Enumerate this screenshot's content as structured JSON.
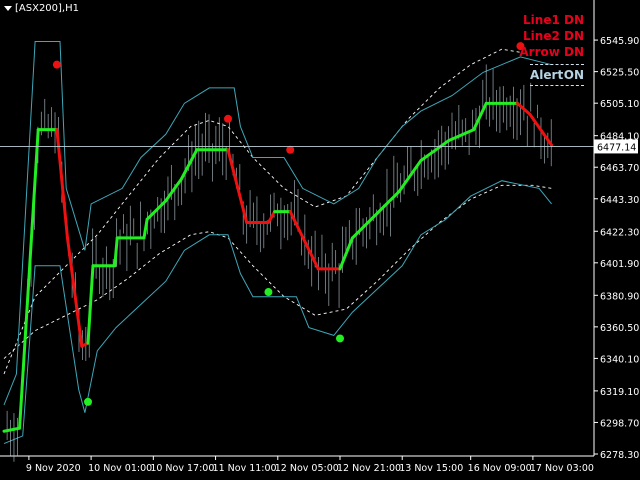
{
  "header": {
    "symbol": "[ASX200],H1"
  },
  "panel": {
    "line1": "Line1 DN",
    "line2": "Line2 DN",
    "arrow": "Arrow  DN",
    "alert_label": "Alert",
    "alert_value": "ON"
  },
  "colors": {
    "background": "#000000",
    "bars": "#b8c8d0",
    "band": "#3fa7b8",
    "envelope": "#ffffff",
    "up": "#22ee22",
    "down": "#ee1111",
    "price_line": "#c0d0d8"
  },
  "chart_data": {
    "type": "line",
    "title": "",
    "xlabel": "",
    "ylabel": "",
    "ylim": [
      6278.3,
      6555.0
    ],
    "x_tick_labels": [
      "9 Nov 2020",
      "10 Nov 01:00",
      "10 Nov 17:00",
      "11 Nov 11:00",
      "12 Nov 05:00",
      "12 Nov 21:00",
      "13 Nov 15:00",
      "16 Nov 09:00",
      "17 Nov 03:00"
    ],
    "y_tick_labels": [
      "6545.90",
      "6525.50",
      "6505.10",
      "6484.10",
      "6463.70",
      "6443.30",
      "6422.30",
      "6401.90",
      "6380.90",
      "6360.50",
      "6340.10",
      "6319.10",
      "6298.70",
      "6278.30"
    ],
    "current_price": "6477.14",
    "trend_steps": [
      {
        "x": 0,
        "y": 6293,
        "dir": "up"
      },
      {
        "x": 2.5,
        "y": 6295,
        "dir": "up"
      },
      {
        "x": 5.5,
        "y": 6488,
        "dir": "up"
      },
      {
        "x": 8.5,
        "y": 6488,
        "dir": "down"
      },
      {
        "x": 10.2,
        "y": 6418,
        "dir": "down"
      },
      {
        "x": 12.5,
        "y": 6348,
        "dir": "down"
      },
      {
        "x": 13.5,
        "y": 6350,
        "dir": "up"
      },
      {
        "x": 14.3,
        "y": 6400,
        "dir": "up"
      },
      {
        "x": 17.8,
        "y": 6400,
        "dir": "up"
      },
      {
        "x": 18.2,
        "y": 6418,
        "dir": "up"
      },
      {
        "x": 22.5,
        "y": 6418,
        "dir": "up"
      },
      {
        "x": 23.0,
        "y": 6430,
        "dir": "up"
      },
      {
        "x": 26.0,
        "y": 6442,
        "dir": "up"
      },
      {
        "x": 28.5,
        "y": 6456,
        "dir": "up"
      },
      {
        "x": 31.0,
        "y": 6475,
        "dir": "up"
      },
      {
        "x": 36.0,
        "y": 6475,
        "dir": "down"
      },
      {
        "x": 39.0,
        "y": 6428,
        "dir": "down"
      },
      {
        "x": 42.5,
        "y": 6428,
        "dir": "down"
      },
      {
        "x": 43.5,
        "y": 6435,
        "dir": "up"
      },
      {
        "x": 46.0,
        "y": 6435,
        "dir": "down"
      },
      {
        "x": 50.5,
        "y": 6398,
        "dir": "down"
      },
      {
        "x": 54.0,
        "y": 6398,
        "dir": "up"
      },
      {
        "x": 56.0,
        "y": 6418,
        "dir": "up"
      },
      {
        "x": 60.0,
        "y": 6434,
        "dir": "up"
      },
      {
        "x": 63.5,
        "y": 6448,
        "dir": "up"
      },
      {
        "x": 67.0,
        "y": 6468,
        "dir": "up"
      },
      {
        "x": 71.5,
        "y": 6481,
        "dir": "up"
      },
      {
        "x": 75.5,
        "y": 6488,
        "dir": "up"
      },
      {
        "x": 77.5,
        "y": 6505,
        "dir": "up"
      },
      {
        "x": 82.5,
        "y": 6505,
        "dir": "down"
      },
      {
        "x": 84.5,
        "y": 6498,
        "dir": "down"
      },
      {
        "x": 88.0,
        "y": 6478,
        "dir": "down"
      }
    ],
    "band_upper": [
      [
        0,
        6310
      ],
      [
        2,
        6330
      ],
      [
        5,
        6545
      ],
      [
        9,
        6545
      ],
      [
        10,
        6450
      ],
      [
        13,
        6410
      ],
      [
        14,
        6440
      ],
      [
        19,
        6450
      ],
      [
        22,
        6470
      ],
      [
        26,
        6485
      ],
      [
        29,
        6505
      ],
      [
        33,
        6515
      ],
      [
        37,
        6515
      ],
      [
        38,
        6490
      ],
      [
        40,
        6470
      ],
      [
        45,
        6470
      ],
      [
        48,
        6450
      ],
      [
        53,
        6440
      ],
      [
        57,
        6450
      ],
      [
        60,
        6470
      ],
      [
        64,
        6490
      ],
      [
        67,
        6500
      ],
      [
        72,
        6510
      ],
      [
        77,
        6525
      ],
      [
        83,
        6535
      ],
      [
        88,
        6530
      ]
    ],
    "band_lower": [
      [
        0,
        6285
      ],
      [
        3,
        6290
      ],
      [
        5,
        6400
      ],
      [
        9,
        6400
      ],
      [
        12,
        6320
      ],
      [
        13,
        6305
      ],
      [
        15,
        6345
      ],
      [
        18,
        6360
      ],
      [
        22,
        6375
      ],
      [
        26,
        6390
      ],
      [
        29,
        6410
      ],
      [
        33,
        6420
      ],
      [
        36,
        6420
      ],
      [
        38,
        6395
      ],
      [
        40,
        6380
      ],
      [
        47,
        6380
      ],
      [
        49,
        6360
      ],
      [
        53,
        6355
      ],
      [
        56,
        6370
      ],
      [
        60,
        6385
      ],
      [
        64,
        6400
      ],
      [
        67,
        6420
      ],
      [
        71,
        6430
      ],
      [
        75,
        6445
      ],
      [
        80,
        6455
      ],
      [
        86,
        6450
      ],
      [
        88,
        6440
      ]
    ],
    "envelope_upper": [
      [
        0,
        6330
      ],
      [
        5,
        6380
      ],
      [
        10,
        6400
      ],
      [
        15,
        6420
      ],
      [
        20,
        6445
      ],
      [
        25,
        6470
      ],
      [
        30,
        6490
      ],
      [
        33,
        6494
      ],
      [
        36,
        6490
      ],
      [
        40,
        6470
      ],
      [
        45,
        6450
      ],
      [
        50,
        6438
      ],
      [
        55,
        6445
      ],
      [
        60,
        6470
      ],
      [
        65,
        6495
      ],
      [
        70,
        6515
      ],
      [
        75,
        6530
      ],
      [
        80,
        6540
      ],
      [
        83,
        6538
      ]
    ],
    "envelope_lower": [
      [
        0,
        6340
      ],
      [
        5,
        6358
      ],
      [
        10,
        6368
      ],
      [
        15,
        6378
      ],
      [
        20,
        6392
      ],
      [
        25,
        6408
      ],
      [
        30,
        6420
      ],
      [
        33,
        6422
      ],
      [
        36,
        6418
      ],
      [
        40,
        6400
      ],
      [
        45,
        6380
      ],
      [
        50,
        6368
      ],
      [
        55,
        6372
      ],
      [
        60,
        6390
      ],
      [
        65,
        6410
      ],
      [
        70,
        6428
      ],
      [
        75,
        6443
      ],
      [
        80,
        6452
      ],
      [
        85,
        6452
      ],
      [
        88,
        6450
      ]
    ],
    "markers": [
      {
        "x": 8.5,
        "y": 6530,
        "color": "down"
      },
      {
        "x": 13.5,
        "y": 6312,
        "color": "up"
      },
      {
        "x": 36.0,
        "y": 6495,
        "color": "down"
      },
      {
        "x": 42.5,
        "y": 6383,
        "color": "up"
      },
      {
        "x": 46.0,
        "y": 6475,
        "color": "down"
      },
      {
        "x": 54.0,
        "y": 6353,
        "color": "up"
      },
      {
        "x": 83.0,
        "y": 6542,
        "color": "down"
      }
    ]
  }
}
